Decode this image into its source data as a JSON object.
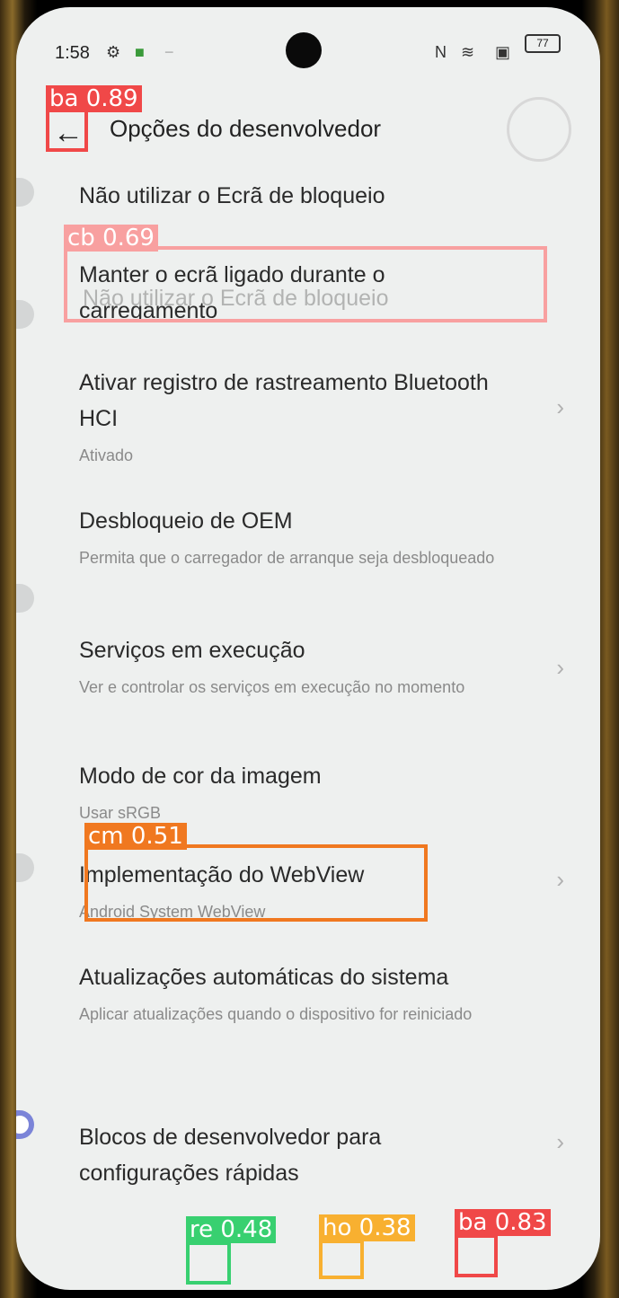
{
  "status": {
    "time": "1:58",
    "battery": "77"
  },
  "appbar": {
    "title": "Opções do desenvolvedor",
    "back_icon": "←"
  },
  "items": [
    {
      "title": "Não utilizar o Ecrã de bloqueio",
      "subtitle": "",
      "control": "toggle",
      "on": false
    },
    {
      "title": "Manter o ecrã ligado durante o carregamento",
      "subtitle": "",
      "control": "toggle",
      "on": false
    },
    {
      "title": "Ativar registro de rastreamento Bluetooth HCI",
      "subtitle": "Ativado",
      "control": "chevron",
      "on": false
    },
    {
      "title": "Desbloqueio de OEM",
      "subtitle": "Permita que o carregador de arranque seja desbloqueado",
      "control": "toggle",
      "on": false
    },
    {
      "title": "Serviços em execução",
      "subtitle": "Ver e controlar os serviços em execução no momento",
      "control": "chevron",
      "on": false
    },
    {
      "title": "Modo de cor da imagem",
      "subtitle": "Usar sRGB",
      "control": "toggle",
      "on": false
    },
    {
      "title": "Implementação do WebView",
      "subtitle": "Android System WebView",
      "control": "chevron",
      "on": false
    },
    {
      "title": "Atualizações automáticas do sistema",
      "subtitle": "Aplicar atualizações quando o dispositivo for reiniciado",
      "control": "toggle",
      "on": true
    },
    {
      "title": "Blocos de desenvolvedor para configurações rápidas",
      "subtitle": "",
      "control": "chevron",
      "on": false
    }
  ],
  "detections": [
    {
      "label": "ba 0.89",
      "color": "#f04848"
    },
    {
      "label": "cb 0.69",
      "color": "#f8a0a0"
    },
    {
      "label": "cm 0.51",
      "color": "#f07820"
    },
    {
      "label": "re 0.48",
      "color": "#38d070"
    },
    {
      "label": "ho 0.38",
      "color": "#f8b030"
    },
    {
      "label": "ba 0.83",
      "color": "#f04848"
    }
  ]
}
